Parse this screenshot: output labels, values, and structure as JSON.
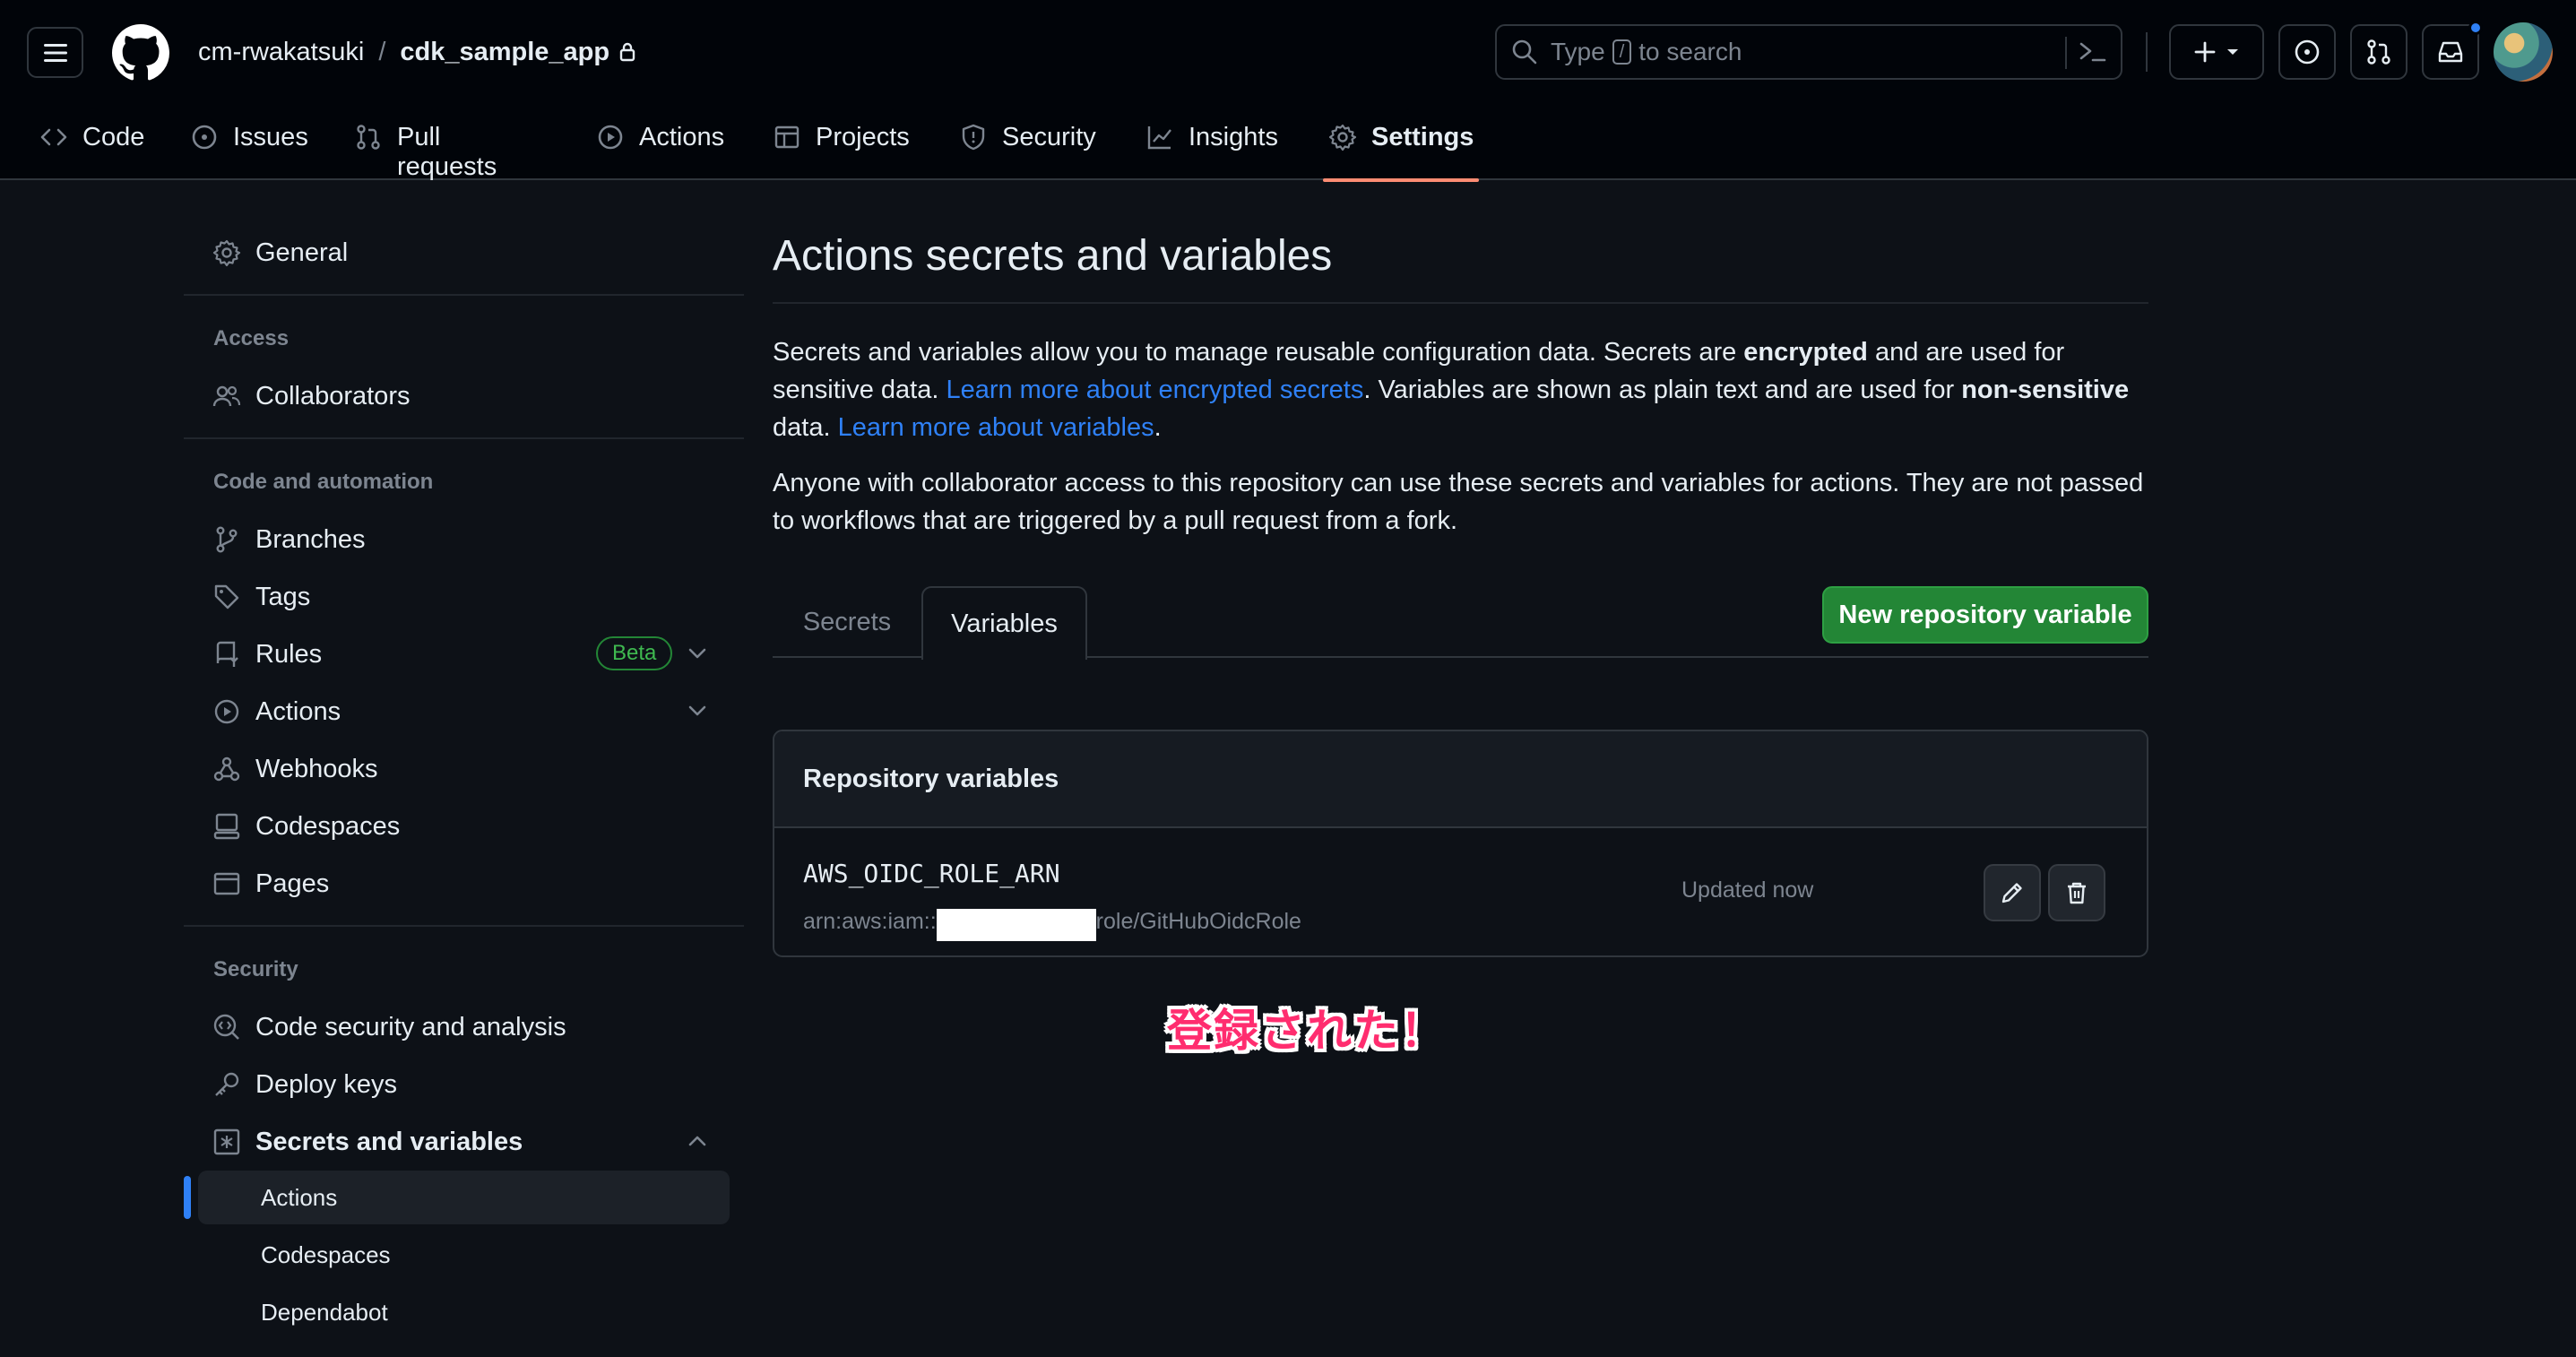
{
  "header": {
    "owner": "cm-rwakatsuki",
    "separator": "/",
    "repo": "cdk_sample_app",
    "search_prefix": "Type",
    "search_key": "/",
    "search_suffix": "to search"
  },
  "repo_tabs": [
    {
      "label": "Code",
      "icon": "code-icon"
    },
    {
      "label": "Issues",
      "icon": "issue-icon"
    },
    {
      "label": "Pull requests",
      "icon": "pull-request-icon"
    },
    {
      "label": "Actions",
      "icon": "play-icon"
    },
    {
      "label": "Projects",
      "icon": "table-icon"
    },
    {
      "label": "Security",
      "icon": "shield-icon"
    },
    {
      "label": "Insights",
      "icon": "graph-icon"
    },
    {
      "label": "Settings",
      "icon": "gear-icon",
      "active": true
    }
  ],
  "sidebar": {
    "general": "General",
    "access_heading": "Access",
    "collaborators": "Collaborators",
    "code_heading": "Code and automation",
    "branches": "Branches",
    "tags": "Tags",
    "rules": "Rules",
    "rules_badge": "Beta",
    "actions": "Actions",
    "webhooks": "Webhooks",
    "codespaces": "Codespaces",
    "pages": "Pages",
    "security_heading": "Security",
    "code_security": "Code security and analysis",
    "deploy_keys": "Deploy keys",
    "secrets_vars": "Secrets and variables",
    "sub_items": [
      "Actions",
      "Codespaces",
      "Dependabot"
    ]
  },
  "main": {
    "title": "Actions secrets and variables",
    "p1_a": "Secrets and variables allow you to manage reusable configuration data. Secrets are ",
    "p1_b": "encrypted",
    "p1_c": " and are used for sensitive data. ",
    "p1_link1": "Learn more about encrypted secrets",
    "p1_d": ". Variables are shown as plain text and are used for ",
    "p1_e": "non-sensitive",
    "p1_f": " data. ",
    "p1_link2": "Learn more about variables",
    "p1_g": ".",
    "p2": "Anyone with collaborator access to this repository can use these secrets and variables for actions. They are not passed to workflows that are triggered by a pull request from a fork.",
    "tab_secrets": "Secrets",
    "tab_variables": "Variables",
    "new_button": "New repository variable",
    "box_title": "Repository variables",
    "var_name": "AWS_OIDC_ROLE_ARN",
    "var_value_prefix": "arn:aws:iam::",
    "var_value_suffix": "role/GitHubOidcRole",
    "var_updated": "Updated now",
    "annotation": "登録された！"
  },
  "colors": {
    "accent_blue": "#2f81f7",
    "primary_green": "#238636",
    "active_tab_underline": "#fd8c73",
    "annotation_pink": "#ff2d6f"
  }
}
